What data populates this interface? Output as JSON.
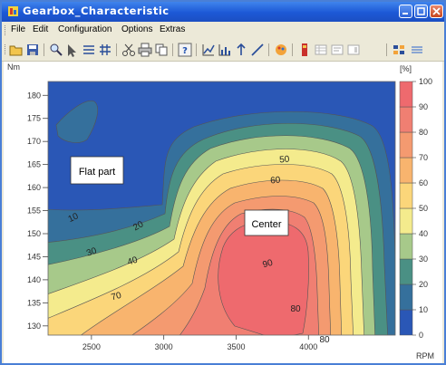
{
  "window": {
    "title": "Gearbox_Characteristic",
    "minimize_label": "_",
    "maximize_label": "□",
    "close_label": "×"
  },
  "menu": [
    {
      "label": "File"
    },
    {
      "label": "Edit"
    },
    {
      "label": "Configuration"
    },
    {
      "label": "Options"
    },
    {
      "label": "Extras"
    }
  ],
  "toolbar_icons": [
    "open-icon",
    "save-icon",
    "zoom-icon",
    "cursor-icon",
    "lines-icon",
    "grid-icon",
    "scissors-icon",
    "print-icon",
    "copy-icon",
    "help-icon",
    "line-chart-icon",
    "bar-chart-icon",
    "arrow-icon",
    "diagonal-icon",
    "palette-icon",
    "book-icon",
    "table-icon",
    "properties-icon",
    "layout-icon",
    "legend-icon"
  ],
  "chart_data": {
    "type": "heatmap",
    "subtype": "contour",
    "x_unit_label": "RPM",
    "y_unit_label": "Nm",
    "x_ticks": [
      2500,
      3000,
      3500,
      4000
    ],
    "y_ticks": [
      130,
      135,
      140,
      145,
      150,
      155,
      160,
      165,
      170,
      175,
      180
    ],
    "xlim": [
      2200,
      4600
    ],
    "ylim": [
      128,
      183
    ],
    "colorbar": {
      "unit_label": "[%]",
      "ticks": [
        0,
        10,
        20,
        30,
        40,
        50,
        60,
        70,
        80,
        90,
        100
      ],
      "colors": [
        "#2a57b6",
        "#35709c",
        "#4a9084",
        "#a7c98a",
        "#f4eb8d",
        "#fbd67a",
        "#f8b46e",
        "#f49a70",
        "#f07f72",
        "#ee6a6e"
      ]
    },
    "contour_labels": [
      "10",
      "20",
      "30",
      "40",
      "50",
      "60",
      "70",
      "80",
      "90",
      "80"
    ],
    "annotations": [
      {
        "text": "Flat part"
      },
      {
        "text": "Center"
      }
    ]
  },
  "colors": {
    "titlebar": "#1c58d6",
    "background_level": "#2a57b6"
  }
}
